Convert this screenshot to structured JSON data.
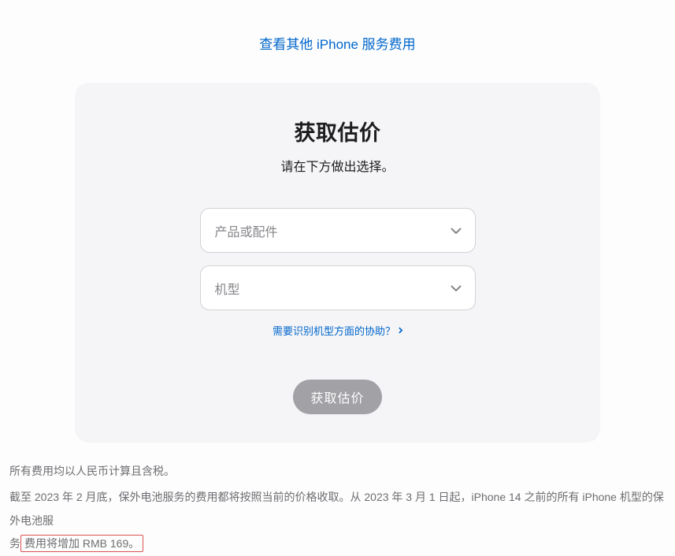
{
  "topLink": {
    "label": "查看其他 iPhone 服务费用"
  },
  "card": {
    "title": "获取估价",
    "subtitle": "请在下方做出选择。",
    "select1": {
      "placeholder": "产品或配件"
    },
    "select2": {
      "placeholder": "机型"
    },
    "helpLink": {
      "label": "需要识别机型方面的协助？"
    },
    "submit": {
      "label": "获取估价"
    }
  },
  "footer": {
    "line1": "所有费用均以人民币计算且含税。",
    "line2_part1": "截至 2023 年 2 月底，保外电池服务的费用都将按照当前的价格收取。从 2023 年 3 月 1 日起，iPhone 14 之前的所有 iPhone 机型的保外电池服",
    "line2_part2_prefix": "务",
    "line2_highlight": "费用将增加 RMB 169。"
  }
}
